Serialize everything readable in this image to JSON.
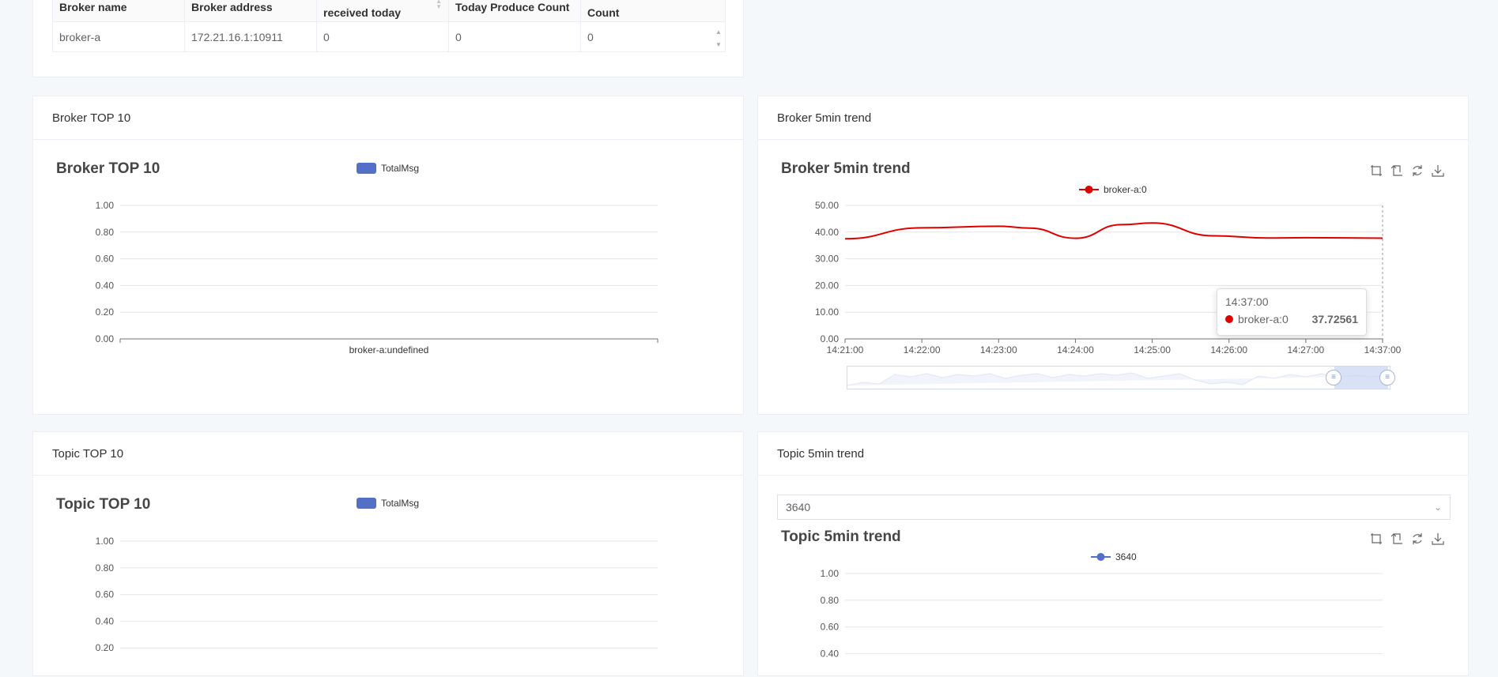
{
  "broker_table": {
    "headers": [
      "Broker name",
      "Broker address",
      "received today",
      "Today Produce Count",
      "Count"
    ],
    "header_line1_partial": [
      "",
      "",
      "",
      "",
      ""
    ],
    "rows": [
      [
        "broker-a",
        "172.21.16.1:10911",
        "0",
        "0",
        "0"
      ]
    ]
  },
  "broker_top10": {
    "card_title": "Broker TOP 10",
    "chart_title": "Broker TOP 10",
    "legend": "TotalMsg"
  },
  "broker_trend": {
    "card_title": "Broker 5min trend",
    "chart_title": "Broker 5min trend",
    "legend": "broker-a:0",
    "tooltip_time": "14:37:00",
    "tooltip_series": "broker-a:0",
    "tooltip_value": "37.72561"
  },
  "topic_top10": {
    "card_title": "Topic TOP 10",
    "chart_title": "Topic TOP 10",
    "legend": "TotalMsg"
  },
  "topic_trend": {
    "card_title": "Topic 5min trend",
    "select_value": "3640",
    "chart_title": "Topic 5min trend",
    "legend": "3640"
  },
  "colors": {
    "bar": "#5470c6",
    "broker_line": "#e00000",
    "topic_line": "#5470c6",
    "grid": "#e6e6e6"
  },
  "icons": [
    "zoom-icon",
    "zoom-reset-icon",
    "restore-icon",
    "download-icon",
    "sort-icon",
    "chevron-down-icon"
  ],
  "chart_data": [
    {
      "type": "bar",
      "title": "Broker TOP 10",
      "categories": [
        "broker-a:undefined"
      ],
      "series": [
        {
          "name": "TotalMsg",
          "values": [
            0
          ]
        }
      ],
      "yticks": [
        "0.00",
        "0.20",
        "0.40",
        "0.60",
        "0.80",
        "1.00"
      ],
      "ylim": [
        0,
        1
      ]
    },
    {
      "type": "line",
      "title": "Broker 5min trend",
      "x": [
        "14:21:00",
        "14:22:00",
        "14:23:00",
        "14:24:00",
        "14:25:00",
        "14:26:00",
        "14:27:00",
        "14:37:00"
      ],
      "series": [
        {
          "name": "broker-a:0",
          "points": [
            [
              0,
              37.5
            ],
            [
              1,
              41.6
            ],
            [
              2,
              42.2
            ],
            [
              2.4,
              41.5
            ],
            [
              3,
              37.7
            ],
            [
              3.6,
              42.8
            ],
            [
              4,
              43.4
            ],
            [
              4.8,
              38.6
            ],
            [
              5.5,
              37.8
            ],
            [
              6,
              37.9
            ],
            [
              7,
              37.73
            ]
          ]
        }
      ],
      "yticks": [
        "0.00",
        "10.00",
        "20.00",
        "30.00",
        "40.00",
        "50.00"
      ],
      "ylim": [
        0,
        50
      ]
    },
    {
      "type": "bar",
      "title": "Topic TOP 10",
      "categories": [],
      "series": [
        {
          "name": "TotalMsg",
          "values": []
        }
      ],
      "yticks": [
        "0.20",
        "0.40",
        "0.60",
        "0.80",
        "1.00"
      ],
      "ylim": [
        0,
        1
      ]
    },
    {
      "type": "line",
      "title": "Topic 5min trend",
      "x": [],
      "series": [
        {
          "name": "3640",
          "points": []
        }
      ],
      "yticks": [
        "0.40",
        "0.60",
        "0.80",
        "1.00"
      ],
      "ylim": [
        0,
        1
      ]
    }
  ]
}
